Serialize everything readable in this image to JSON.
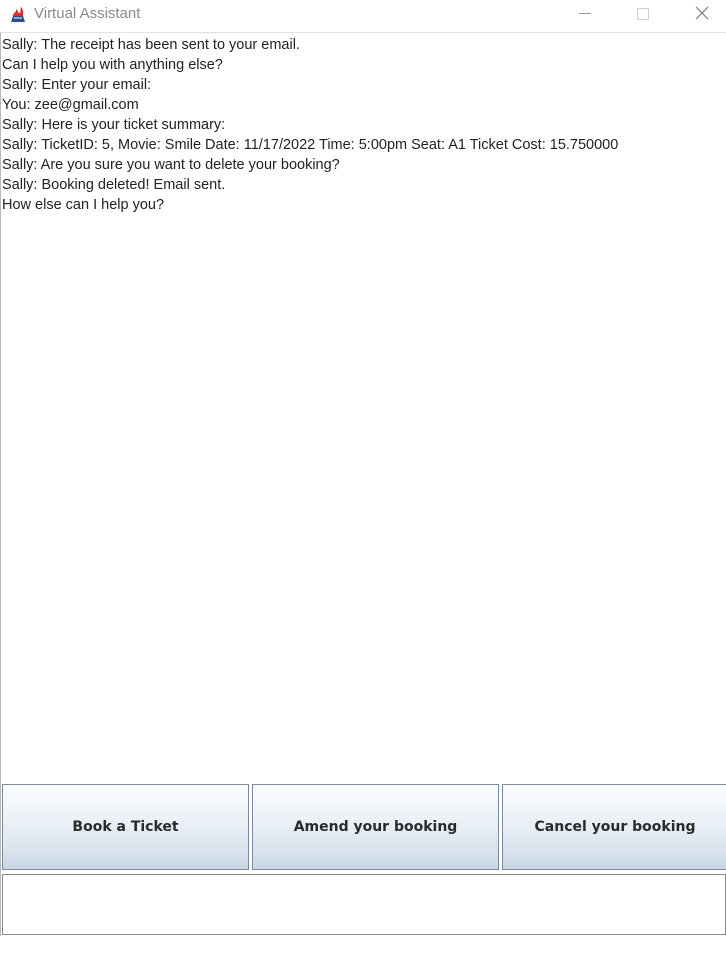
{
  "window": {
    "title": "Virtual Assistant",
    "icon": "java-coffee-cup-icon",
    "controls": [
      "minimize-icon",
      "maximize-icon",
      "close-icon"
    ]
  },
  "chat": {
    "lines": [
      "Sally: The receipt has been sent to your email.",
      "Can I help you with anything else?",
      "Sally: Enter your email:",
      "You: zee@gmail.com",
      "Sally: Here is your ticket summary:",
      "Sally: TicketID: 5, Movie: Smile Date: 11/17/2022 Time: 5:00pm Seat: A1 Ticket Cost: 15.750000",
      "Sally: Are you sure you want to delete your booking?",
      "Sally: Booking deleted! Email sent.",
      "How else can I help you?"
    ]
  },
  "actions": {
    "book_label": "Book a Ticket",
    "amend_label": "Amend your booking",
    "cancel_label": "Cancel your booking"
  },
  "input": {
    "value": "",
    "placeholder": ""
  },
  "colors": {
    "title_text": "#8a8a8a",
    "button_gradient_top": "#fbfcfe",
    "button_gradient_bottom": "#c9d6e3",
    "button_border": "#7a8a9c"
  }
}
